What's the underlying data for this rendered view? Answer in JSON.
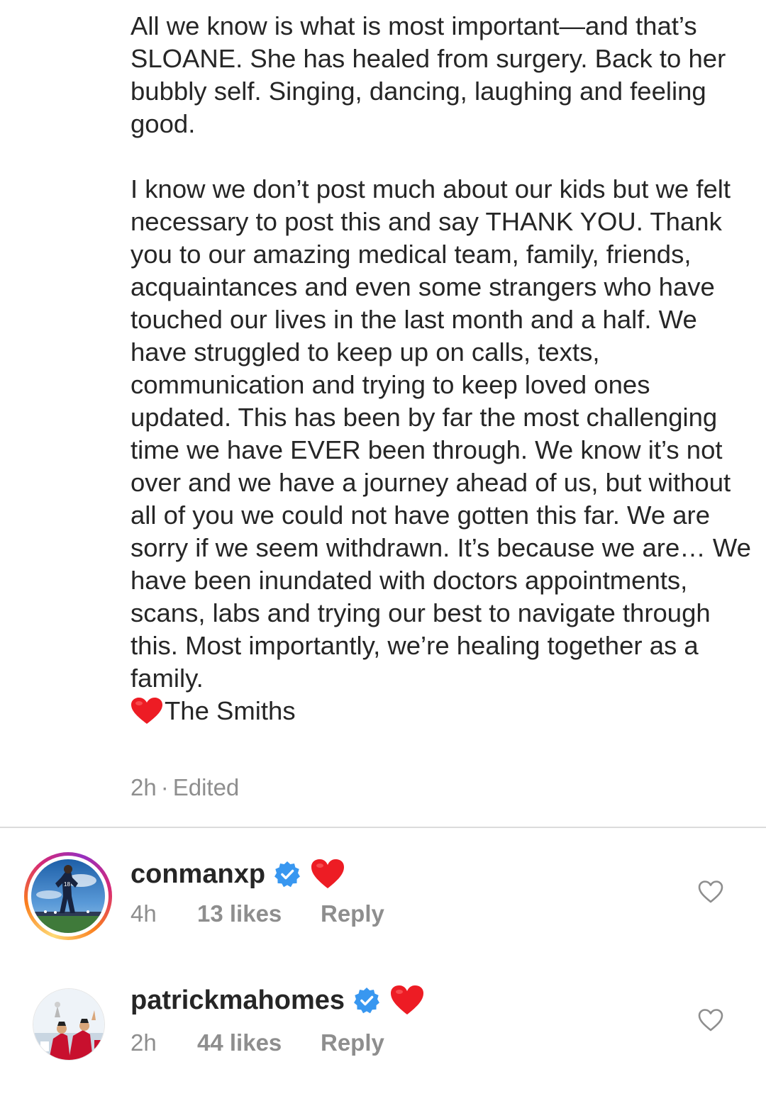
{
  "post": {
    "caption_para1": "All we know is what is most important—and that’s SLOANE. She has healed from surgery. Back to her bubbly self. Singing, dancing, laughing and feeling good.",
    "caption_para2": "I know we don’t post much about our kids but we felt necessary to post this and say THANK YOU. Thank you to our amazing  medical team, family, friends, acquaintances and even some strangers who have touched our lives in the last month and a half. We have struggled to keep up on calls, texts, communication and trying to keep loved ones updated. This has been by far the most challenging time we have EVER been through. We know it’s not over and we have a journey ahead of us, but without all of you we could not have gotten this far. We are sorry if we seem withdrawn. It’s because we are… We have been inundated with doctors appointments, scans, labs and trying our best to navigate through this. Most importantly, we’re healing together as a family.",
    "signoff": "The Smiths",
    "signoff_emoji": "red-heart-emoji",
    "time": "2h",
    "separator": "·",
    "edited": "Edited"
  },
  "comments": [
    {
      "username": "conmanxp",
      "verified": true,
      "emoji": "red-heart-emoji",
      "time": "4h",
      "likes": "13 likes",
      "reply_label": "Reply",
      "has_story_ring": true
    },
    {
      "username": "patrickmahomes",
      "verified": true,
      "emoji": "red-heart-emoji",
      "time": "2h",
      "likes": "44 likes",
      "reply_label": "Reply",
      "has_story_ring": false
    }
  ],
  "colors": {
    "text": "#262626",
    "secondary": "#8e8e8e",
    "verified_blue": "#3897f0",
    "heart_red": "#ed1c24",
    "divider": "#dbdbdb"
  },
  "icons": {
    "like": "heart-outline-icon",
    "verified": "verified-badge-icon"
  }
}
